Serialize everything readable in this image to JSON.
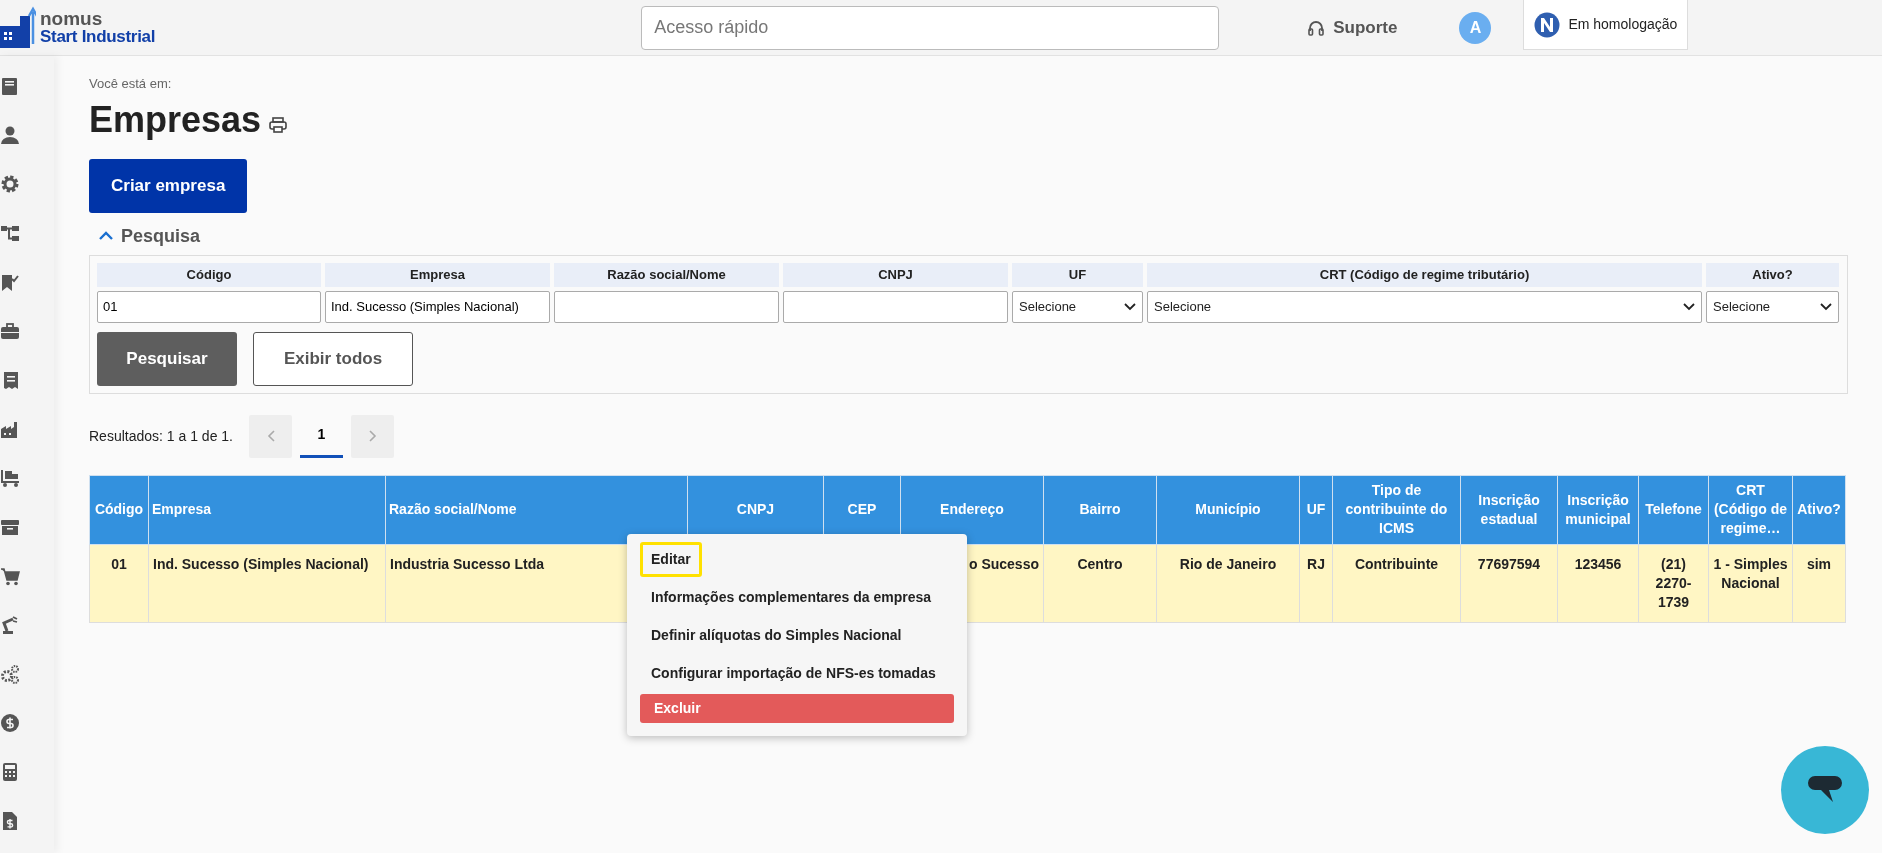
{
  "header": {
    "logo_line1": "nomus",
    "logo_line2": "Start Industrial",
    "quick_access": {
      "placeholder": "Acesso rápido"
    },
    "support": "Suporte",
    "avatar": "A",
    "environment": "Em homologação"
  },
  "breadcrumb_label": "Você está em:",
  "page_title": "Empresas",
  "create_button": "Criar empresa",
  "search": {
    "title": "Pesquisa",
    "expanded": true,
    "fields": [
      {
        "label": "Código",
        "kind": "text",
        "value": "01"
      },
      {
        "label": "Empresa",
        "kind": "text",
        "value": "Ind. Sucesso (Simples Nacional)"
      },
      {
        "label": "Razão social/Nome",
        "kind": "text"
      },
      {
        "label": "CNPJ",
        "kind": "text"
      },
      {
        "label": "UF",
        "kind": "select",
        "value": "Selecione"
      },
      {
        "label": "CRT (Código de regime tributário)",
        "kind": "select",
        "value": "Selecione"
      },
      {
        "label": "Ativo?",
        "kind": "select",
        "value": "Selecione"
      }
    ],
    "buttons": [
      {
        "label": "Pesquisar",
        "kind": "primary"
      },
      {
        "label": "Exibir todos",
        "kind": "outline"
      }
    ]
  },
  "results": {
    "summary": "Resultados: 1 a 1 de 1.",
    "pages": [
      {
        "label": "1",
        "selected": true
      }
    ]
  },
  "table": {
    "columns": [
      {
        "label": "Código"
      },
      {
        "label": "Empresa"
      },
      {
        "label": "Razão social/Nome"
      },
      {
        "label": "CNPJ"
      },
      {
        "label": "CEP"
      },
      {
        "label": "Endereço"
      },
      {
        "label": "Bairro"
      },
      {
        "label": "Município"
      },
      {
        "label": "UF"
      },
      {
        "label": "Tipo de contribuinte do ICMS"
      },
      {
        "label": "Inscrição estadual"
      },
      {
        "label": "Inscrição municipal"
      },
      {
        "label": "Telefone"
      },
      {
        "label": "CRT (Código de regime…"
      },
      {
        "label": "Ativo?"
      }
    ],
    "rows": [
      {
        "selected": true,
        "cells": [
          "01",
          "Ind. Sucesso (Simples Nacional)",
          "Industria Sucesso Ltda",
          null,
          null,
          "o Sucesso",
          "Centro",
          "Rio de Janeiro",
          "RJ",
          "Contribuinte",
          "77697594",
          "123456",
          "(21) 2270-1739",
          "1 - Simples Nacional",
          "sim"
        ]
      }
    ]
  },
  "context_menu": {
    "items": [
      {
        "label": "Editar",
        "kind": "normal",
        "highlighted": true
      },
      {
        "label": "Informações complementares da empresa",
        "kind": "normal",
        "highlighted": false
      },
      {
        "label": "Definir alíquotas do Simples Nacional",
        "kind": "normal",
        "highlighted": false
      },
      {
        "label": "Configurar importação de NFS-es tomadas",
        "kind": "normal",
        "highlighted": false
      },
      {
        "label": "Excluir",
        "kind": "danger",
        "highlighted": false
      }
    ]
  }
}
